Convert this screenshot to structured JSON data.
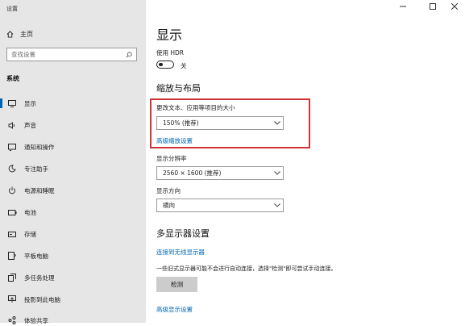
{
  "window": {
    "title": "设置"
  },
  "sidebar": {
    "home_label": "主页",
    "search_placeholder": "查找设置",
    "section_label": "系统",
    "items": [
      {
        "label": "显示",
        "icon": "monitor-icon"
      },
      {
        "label": "声音",
        "icon": "speaker-icon"
      },
      {
        "label": "通知和操作",
        "icon": "notification-icon"
      },
      {
        "label": "专注助手",
        "icon": "moon-icon"
      },
      {
        "label": "电源和睡眠",
        "icon": "power-icon"
      },
      {
        "label": "电池",
        "icon": "battery-icon"
      },
      {
        "label": "存储",
        "icon": "storage-icon"
      },
      {
        "label": "平板电脑",
        "icon": "tablet-icon"
      },
      {
        "label": "多任务处理",
        "icon": "multitask-icon"
      },
      {
        "label": "投影到此电脑",
        "icon": "project-icon"
      },
      {
        "label": "体验共享",
        "icon": "share-icon"
      }
    ]
  },
  "main": {
    "title": "显示",
    "hdr_label": "使用 HDR",
    "hdr_state": "关",
    "scale_heading": "缩放与布局",
    "scale_label": "更改文本、应用等项目的大小",
    "scale_value": "150% (推荐)",
    "advanced_scale_link": "高级缩放设置",
    "resolution_label": "显示分辨率",
    "resolution_value": "2560 × 1600 (推荐)",
    "orientation_label": "显示方向",
    "orientation_value": "横向",
    "multi_heading": "多显示器设置",
    "wireless_link": "连接到无线显示器",
    "note": "一些旧式显示器可能不会进行自动连接，选择\"检测\"即可尝试手动连接。",
    "detect_button": "检测",
    "advanced_display_link": "高级显示设置"
  },
  "colors": {
    "accent": "#0063b1",
    "highlight": "#d13438",
    "sidebar_bg": "#e6e6e6"
  }
}
